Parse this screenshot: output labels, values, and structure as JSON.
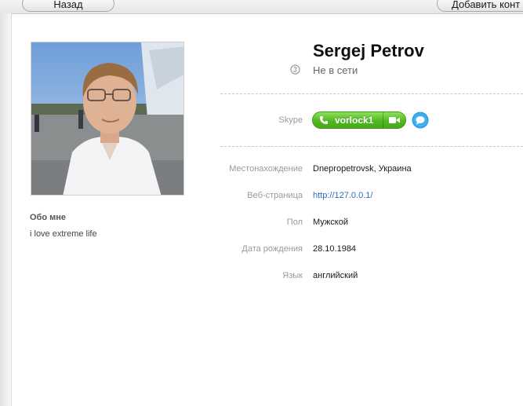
{
  "toolbar": {
    "back_label": "Назад",
    "add_label": "Добавить конт"
  },
  "profile": {
    "name": "Sergej Petrov",
    "status": "Не в сети",
    "about_title": "Обо мне",
    "about_text": "i love extreme life"
  },
  "skype": {
    "label": "Skype",
    "username": "vorlock1",
    "accent_color": "#52b821",
    "chat_color": "#2a9be0"
  },
  "details": {
    "location_label": "Местонахождение",
    "location_value": "Dnepropetrovsk, Украина",
    "website_label": "Веб-страница",
    "website_value": "http://127.0.0.1/",
    "gender_label": "Пол",
    "gender_value": "Мужской",
    "birthday_label": "Дата рождения",
    "birthday_value": "28.10.1984",
    "language_label": "Язык",
    "language_value": "английский"
  },
  "icons": {
    "status": "skype-offline-icon",
    "call": "phone-icon",
    "video": "video-camera-icon",
    "chat": "chat-bubble-icon"
  }
}
